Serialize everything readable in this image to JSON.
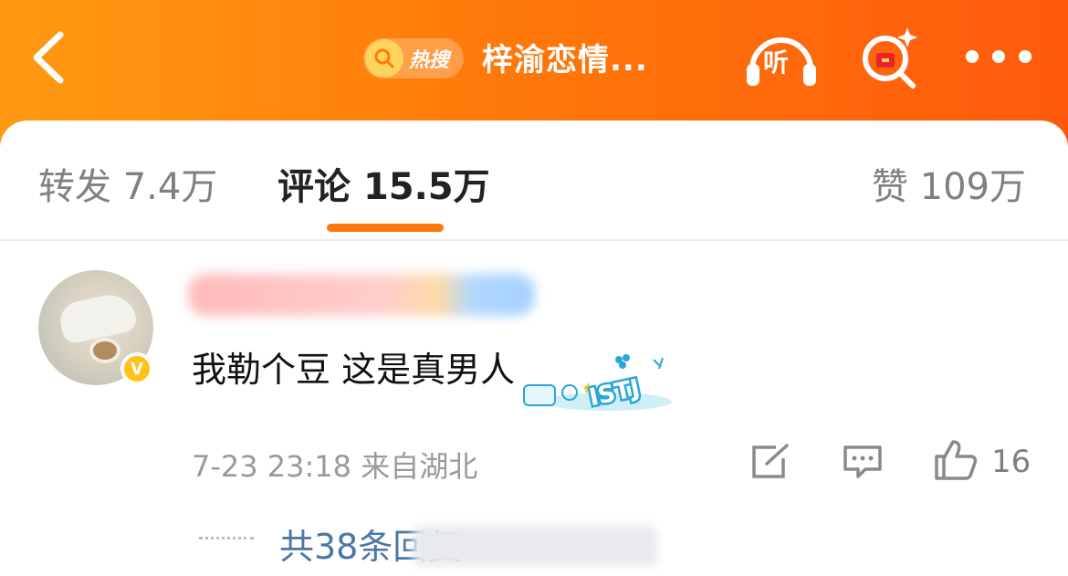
{
  "header": {
    "hot_badge_label": "热搜",
    "topic_title": "梓渝恋情...",
    "listen_label": "听",
    "icons": [
      "back-arrow-icon",
      "search-icon",
      "headphones-icon",
      "ai-search-icon",
      "more-icon"
    ]
  },
  "tabs": [
    {
      "label": "转发",
      "count": "7.4万"
    },
    {
      "label": "评论",
      "count": "15.5万",
      "active": true
    },
    {
      "label": "赞",
      "count": "109万"
    }
  ],
  "comment": {
    "text": "我勒个豆 这是真男人",
    "verified_badge": "V",
    "sticker_text": "ISTJ",
    "time": "7-23 23:18",
    "location": "来自湖北",
    "like_count": "16",
    "replies_text": "共38条回复"
  },
  "colors": {
    "header_orange": "#ff7a0a",
    "link_blue": "#4a76a8",
    "verified_yellow": "#ffc21a"
  }
}
